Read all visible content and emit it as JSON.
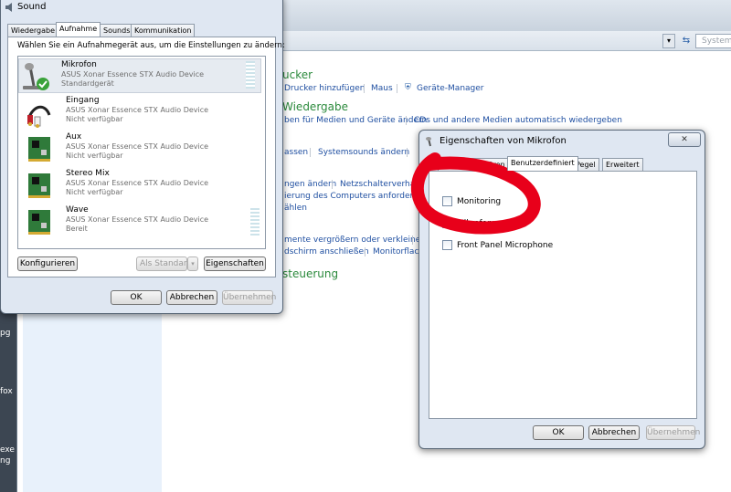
{
  "desktop": {
    "labels": [
      "pg",
      "fox",
      "exe -",
      "ng"
    ]
  },
  "control_panel": {
    "search_placeholder": "Systemsteu",
    "heading_printers": "ucker",
    "links_printers": [
      "Drucker hinzufügen",
      "Maus",
      "Geräte-Manager"
    ],
    "heading_autoplay": "Wiedergabe",
    "links_autoplay": [
      "ben für Medien und Geräte ändern",
      "CDs und andere Medien automatisch wiedergeben"
    ],
    "links_sound": [
      "assen",
      "Systemsounds ändern"
    ],
    "links_power": [
      "ngen ändern",
      "Netzschalterverha",
      "ierung des Computers anforderr",
      "ählen"
    ],
    "links_display": [
      "mente vergrößern oder verkleinern",
      "dschirm anschließen",
      "Monitorflack"
    ],
    "heading_control": "steuerung"
  },
  "sound": {
    "title": "Sound",
    "tabs": [
      "Wiedergabe",
      "Aufnahme",
      "Sounds",
      "Kommunikation"
    ],
    "instruction": "Wählen Sie ein Aufnahmegerät aus, um die Einstellungen zu ändern:",
    "devices": [
      {
        "name": "Mikrofon",
        "driver": "ASUS Xonar Essence STX Audio Device",
        "status": "Standardgerät",
        "icon": "microphone-icon"
      },
      {
        "name": "Eingang",
        "driver": "ASUS Xonar Essence STX Audio Device",
        "status": "Nicht verfügbar",
        "icon": "audio-cable-icon"
      },
      {
        "name": "Aux",
        "driver": "ASUS Xonar Essence STX Audio Device",
        "status": "Nicht verfügbar",
        "icon": "sound-card-icon"
      },
      {
        "name": "Stereo Mix",
        "driver": "ASUS Xonar Essence STX Audio Device",
        "status": "Nicht verfügbar",
        "icon": "sound-card-icon"
      },
      {
        "name": "Wave",
        "driver": "ASUS Xonar Essence STX Audio Device",
        "status": "Bereit",
        "icon": "sound-card-icon"
      }
    ],
    "buttons": {
      "configure": "Konfigurieren",
      "default": "Als Standard",
      "properties": "Eigenschaften",
      "ok": "OK",
      "cancel": "Abbrechen",
      "apply": "Übernehmen"
    }
  },
  "props": {
    "title": "Eigenschaften von Mikrofon",
    "tabs": [
      "ein",
      "Abhören",
      "Benutzerdefiniert",
      "Pegel",
      "Erweitert"
    ],
    "checkboxes": [
      "Monitoring",
      "Mikrofonverst",
      "Front Panel Microphone"
    ],
    "buttons": {
      "ok": "OK",
      "cancel": "Abbrechen",
      "apply": "Übernehmen"
    }
  },
  "colors": {
    "link": "#1f4fa1",
    "heading_green": "#2b8a3c",
    "annotation_red": "#e8001a",
    "selected_row": "#e6ebf1",
    "check_green": "#3aa23a"
  }
}
